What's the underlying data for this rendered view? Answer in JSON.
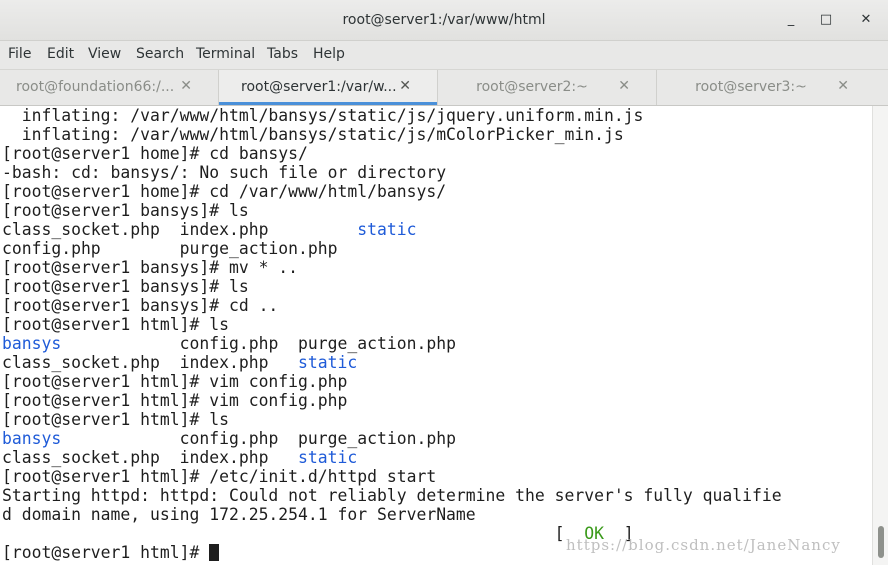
{
  "window": {
    "title": "root@server1:/var/www/html",
    "minimize": "_",
    "maximize": "□",
    "close": "✕"
  },
  "menu": [
    "File",
    "Edit",
    "View",
    "Search",
    "Terminal",
    "Tabs",
    "Help"
  ],
  "tabs": [
    {
      "label": "root@foundation66:/...",
      "close": "✕"
    },
    {
      "label": "root@server1:/var/w...",
      "close": "✕"
    },
    {
      "label": "root@server2:~",
      "close": "✕"
    },
    {
      "label": "root@server3:~",
      "close": "✕"
    }
  ],
  "terminal": {
    "lines": [
      [
        "  inflating: /var/www/html/bansys/static/js/jquery.uniform.min.js"
      ],
      [
        "  inflating: /var/www/html/bansys/static/js/mColorPicker_min.js"
      ],
      [
        "[root@server1 home]# cd bansys/"
      ],
      [
        "-bash: cd: bansys/: No such file or directory"
      ],
      [
        "[root@server1 home]# cd /var/www/html/bansys/"
      ],
      [
        "[root@server1 bansys]# ls"
      ],
      [
        "class_socket.php  index.php         ",
        "static"
      ],
      [
        "config.php        purge_action.php"
      ],
      [
        "[root@server1 bansys]# mv * .."
      ],
      [
        "[root@server1 bansys]# ls"
      ],
      [
        "[root@server1 bansys]# cd .."
      ],
      [
        "[root@server1 html]# ls"
      ],
      [
        "",
        "bansys",
        "            config.php  purge_action.php"
      ],
      [
        "class_socket.php  index.php   ",
        "static"
      ],
      [
        "[root@server1 html]# vim config.php"
      ],
      [
        "[root@server1 html]# vim config.php"
      ],
      [
        "[root@server1 html]# ls"
      ],
      [
        "",
        "bansys",
        "            config.php  purge_action.php"
      ],
      [
        "class_socket.php  index.php   ",
        "static"
      ],
      [
        "[root@server1 html]# /etc/init.d/httpd start"
      ],
      [
        "Starting httpd: httpd: Could not reliably determine the server's fully qualifie"
      ],
      [
        "d domain name, using 172.25.254.1 for ServerName"
      ],
      [
        "                                                        [  ",
        "OK",
        "  ]"
      ],
      [
        "[root@server1 html]# "
      ]
    ]
  },
  "watermark": "https://blog.csdn.net/JaneNancy",
  "colors": {
    "directory": "#1f5bd8",
    "ok": "#3a9a1a",
    "accent": "#4a90d9",
    "background": "#ffffff"
  }
}
